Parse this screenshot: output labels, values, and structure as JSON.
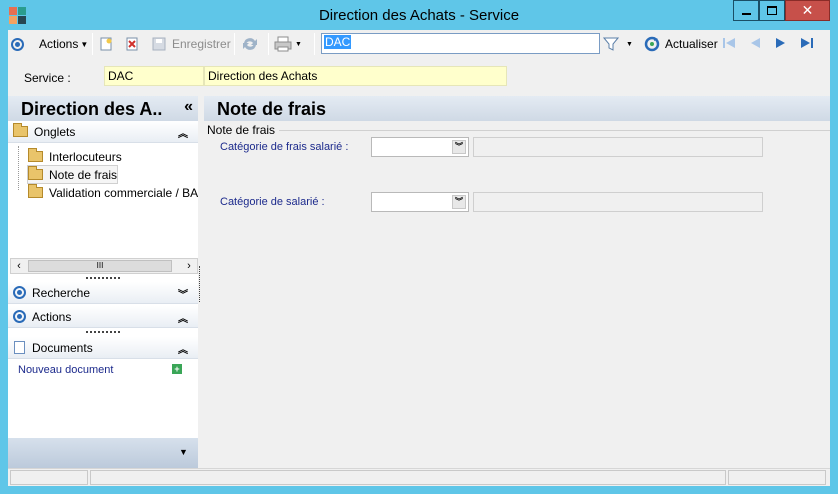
{
  "window": {
    "title": "Direction des Achats -  Service"
  },
  "toolbar": {
    "actions_label": "Actions",
    "save_label": "Enregistrer",
    "search_value": "DAC",
    "refresh_label": "Actualiser"
  },
  "service": {
    "label": "Service :",
    "code": "DAC",
    "name": "Direction des Achats"
  },
  "left_panel": {
    "title": "Direction des A..",
    "collapse_glyph": "«",
    "sections": {
      "onglets": "Onglets",
      "recherche": "Recherche",
      "actions": "Actions",
      "documents": "Documents"
    },
    "tree_items": [
      "Interlocuteurs",
      "Note de frais",
      "Validation commerciale / BAP"
    ],
    "scroll_thumb": "III",
    "new_document_link": "Nouveau document"
  },
  "main": {
    "title": "Note de frais",
    "group_label": "Note de frais",
    "fields": [
      {
        "label": "Catégorie de frais salarié :",
        "value": ""
      },
      {
        "label": "Catégorie de salarié :",
        "value": ""
      }
    ]
  },
  "colors": {
    "window_frame": "#5fc6e8",
    "field_highlight": "#ffffcc",
    "label_blue": "#1c2a8c",
    "nav_blue": "#2a6bb8"
  }
}
